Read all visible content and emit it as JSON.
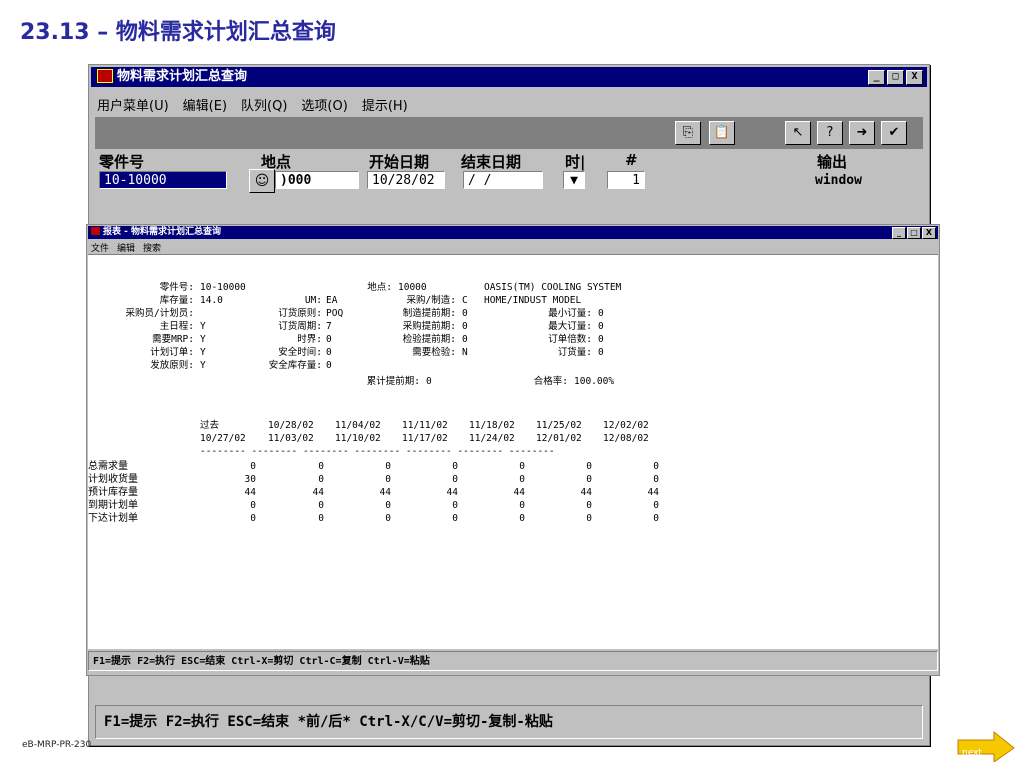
{
  "slide": {
    "title": "23.13 – 物料需求计划汇总查询",
    "footer_id": "eB-MRP-PR-230",
    "next_label": "next"
  },
  "main_window": {
    "title": "物料需求计划汇总查询",
    "menu": [
      "用户菜单(U)",
      "编辑(E)",
      "队列(Q)",
      "选项(O)",
      "提示(H)"
    ],
    "fields": {
      "part_label": "零件号",
      "part_value": "10-10000",
      "site_label": "地点",
      "site_value": ")000",
      "start_label": "开始日期",
      "start_value": "10/28/02",
      "end_label": "结束日期",
      "end_value": " /  / ",
      "time_label": "时|",
      "time_value": "▼",
      "hash_label": "#",
      "hash_value": "1",
      "output_label": "输出",
      "output_value": "window"
    },
    "status": "F1=提示 F2=执行 ESC=结束 *前/后* Ctrl-X/C/V=剪切-复制-粘贴",
    "window_buttons": [
      "_",
      "□",
      "X"
    ]
  },
  "report_window": {
    "title": "报表 - 物料需求计划汇总查询",
    "menu": [
      "文件",
      "编辑",
      "搜索"
    ],
    "status": "F1=提示 F2=执行 ESC=结束 Ctrl-X=剪切 Ctrl-C=复制 Ctrl-V=粘贴",
    "header": {
      "part_label": "零件号:",
      "part": "10-10000",
      "site_label": "地点:",
      "site": "10000",
      "desc1": "OASIS(TM) COOLING SYSTEM",
      "onhand_label": "库存量:",
      "onhand": "14.0",
      "um_label": "UM:",
      "um": "EA",
      "pm_label": "采购/制造:",
      "pm": "C",
      "desc2": "HOME/INDUST MODEL",
      "buyer_label": "采购员/计划员:",
      "order_policy_label": "订货原则:",
      "order_policy": "POQ",
      "mfg_lt_label": "制造提前期:",
      "mfg_lt": "0",
      "min_label": "最小订量:",
      "min": "0",
      "master_label": "主日程:",
      "master": "Y",
      "order_period_label": "订货周期:",
      "order_period": "7",
      "pur_lt_label": "采购提前期:",
      "pur_lt": "0",
      "max_label": "最大订量:",
      "max": "0",
      "mrp_label": "需要MRP:",
      "mrp": "Y",
      "horizon_label": "时界:",
      "horizon": "0",
      "insp_lt_label": "检验提前期:",
      "insp_lt": "0",
      "mult_label": "订单倍数:",
      "mult": "0",
      "plan_label": "计划订单:",
      "plan": "Y",
      "safety_time_label": "安全时间:",
      "safety_time": "0",
      "insp_req_label": "需要检验:",
      "insp_req": "N",
      "order_qty_label": "订货量:",
      "order_qty": "0",
      "release_label": "发放原则:",
      "release": "Y",
      "safety_stock_label": "安全库存量:",
      "safety_stock": "0",
      "cum_lt_label": "累计提前期:",
      "cum_lt": "0",
      "yield_label": "合格率:",
      "yield": "100.00%"
    },
    "columns": [
      {
        "top": "过去",
        "bottom": "10/27/02"
      },
      {
        "top": "10/28/02",
        "bottom": "11/03/02"
      },
      {
        "top": "11/04/02",
        "bottom": "11/10/02"
      },
      {
        "top": "11/11/02",
        "bottom": "11/17/02"
      },
      {
        "top": "11/18/02",
        "bottom": "11/24/02"
      },
      {
        "top": "11/25/02",
        "bottom": "12/01/02"
      },
      {
        "top": "12/02/02",
        "bottom": "12/08/02"
      }
    ],
    "dashes": "-------- -------- -------- -------- -------- -------- --------",
    "rows": [
      {
        "label": "总需求量",
        "values": [
          "0",
          "0",
          "0",
          "0",
          "0",
          "0",
          "0"
        ]
      },
      {
        "label": "计划收货量",
        "values": [
          "30",
          "0",
          "0",
          "0",
          "0",
          "0",
          "0"
        ]
      },
      {
        "label": "预计库存量",
        "values": [
          "44",
          "44",
          "44",
          "44",
          "44",
          "44",
          "44"
        ]
      },
      {
        "label": "到期计划单",
        "values": [
          "0",
          "0",
          "0",
          "0",
          "0",
          "0",
          "0"
        ]
      },
      {
        "label": "下达计划单",
        "values": [
          "0",
          "0",
          "0",
          "0",
          "0",
          "0",
          "0"
        ]
      }
    ]
  }
}
